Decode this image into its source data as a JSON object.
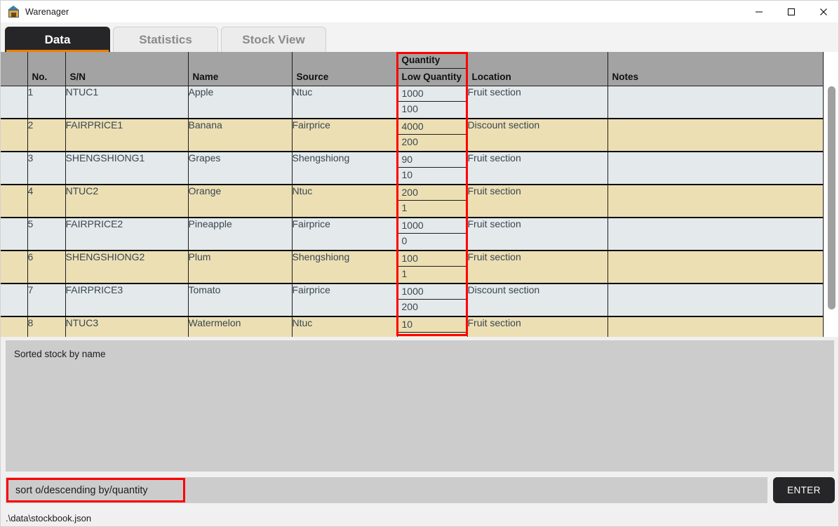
{
  "window": {
    "title": "Warenager",
    "icon": "warehouse-icon",
    "controls": {
      "minimize": "—",
      "maximize": "☐",
      "close": "✕"
    }
  },
  "tabs": [
    {
      "label": "Data",
      "active": true
    },
    {
      "label": "Statistics",
      "active": false
    },
    {
      "label": "Stock View",
      "active": false
    }
  ],
  "table": {
    "columns": [
      {
        "key": "blank",
        "label": ""
      },
      {
        "key": "no",
        "label": "No."
      },
      {
        "key": "sn",
        "label": "S/N"
      },
      {
        "key": "name",
        "label": "Name"
      },
      {
        "key": "source",
        "label": "Source"
      },
      {
        "key": "quantity",
        "label": "Quantity",
        "sublabel": "Low Quantity"
      },
      {
        "key": "location",
        "label": "Location"
      },
      {
        "key": "notes",
        "label": "Notes"
      }
    ],
    "rows": [
      {
        "no": "1",
        "sn": "NTUC1",
        "name": "Apple",
        "source": "Ntuc",
        "quantity": "1000",
        "low_quantity": "100",
        "location": "Fruit section",
        "notes": ""
      },
      {
        "no": "2",
        "sn": "FAIRPRICE1",
        "name": "Banana",
        "source": "Fairprice",
        "quantity": "4000",
        "low_quantity": "200",
        "location": "Discount section",
        "notes": ""
      },
      {
        "no": "3",
        "sn": "SHENGSHIONG1",
        "name": "Grapes",
        "source": "Shengshiong",
        "quantity": "90",
        "low_quantity": "10",
        "location": "Fruit section",
        "notes": ""
      },
      {
        "no": "4",
        "sn": "NTUC2",
        "name": "Orange",
        "source": "Ntuc",
        "quantity": "200",
        "low_quantity": "1",
        "location": "Fruit section",
        "notes": ""
      },
      {
        "no": "5",
        "sn": "FAIRPRICE2",
        "name": "Pineapple",
        "source": "Fairprice",
        "quantity": "1000",
        "low_quantity": "0",
        "location": "Fruit section",
        "notes": ""
      },
      {
        "no": "6",
        "sn": "SHENGSHIONG2",
        "name": "Plum",
        "source": "Shengshiong",
        "quantity": "100",
        "low_quantity": "1",
        "location": "Fruit section",
        "notes": ""
      },
      {
        "no": "7",
        "sn": "FAIRPRICE3",
        "name": "Tomato",
        "source": "Fairprice",
        "quantity": "1000",
        "low_quantity": "200",
        "location": "Discount section",
        "notes": ""
      },
      {
        "no": "8",
        "sn": "NTUC3",
        "name": "Watermelon",
        "source": "Ntuc",
        "quantity": "10",
        "low_quantity": "",
        "location": "Fruit section",
        "notes": ""
      }
    ]
  },
  "result": {
    "text": "Sorted stock by name"
  },
  "command": {
    "value": "sort o/descending by/quantity",
    "placeholder": "",
    "enter_label": "ENTER"
  },
  "status": {
    "text": ".\\data\\stockbook.json"
  },
  "annotations": {
    "quantity_column_highlight": "#ff0000",
    "command_input_highlight": "#ff0000"
  },
  "colors": {
    "accent": "#f08000",
    "active_tab_bg": "#262629",
    "header_bg": "#a3a3a3",
    "row_odd": "#e4e9eb",
    "row_even": "#ecdfb4",
    "panel_bg": "#cccccc"
  }
}
